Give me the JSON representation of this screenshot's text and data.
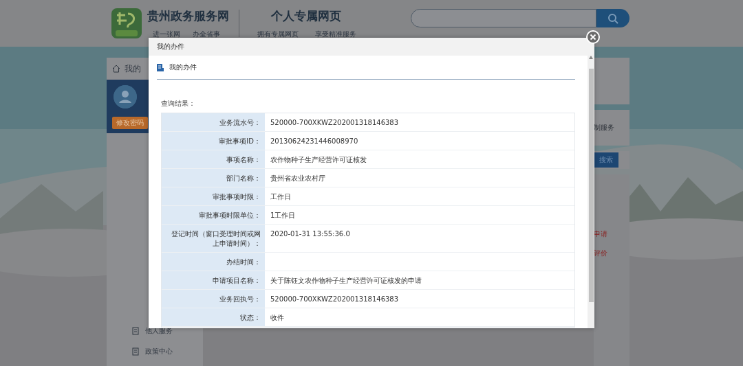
{
  "header": {
    "site_title": "贵州政务服务网",
    "page_title": "个人专属网页",
    "nav": [
      "进一张网",
      "办全省事",
      "拥有专属网页",
      "享受精准服务"
    ]
  },
  "sidebar": {
    "breadcrumb": "我的",
    "button": "修改密码",
    "items": [
      {
        "label": "他人服务"
      },
      {
        "label": "政策中心"
      }
    ]
  },
  "right_panel": {
    "service": "制服务",
    "search_button": "搜索",
    "links": [
      "申请",
      "评价"
    ]
  },
  "dialog": {
    "title": "我的办件",
    "heading": "我的办件",
    "result_label": "查询结果：",
    "rows": [
      {
        "label": "业务流水号：",
        "value": "520000-700XKWZ202001318146383"
      },
      {
        "label": "审批事项ID：",
        "value": "20130624231446008970"
      },
      {
        "label": "事项名称：",
        "value": "农作物种子生产经营许可证核发"
      },
      {
        "label": "部门名称：",
        "value": "贵州省农业农村厅"
      },
      {
        "label": "审批事项时限：",
        "value": "工作日"
      },
      {
        "label": "审批事项时限单位：",
        "value": "1工作日"
      },
      {
        "label": "登记时间（窗口受理时间或网上申请时间）：",
        "value": "2020-01-31 13:55:36.0"
      },
      {
        "label": "办结时间：",
        "value": ""
      },
      {
        "label": "申请项目名称：",
        "value": "关于陈钰文农作物种子生产经营许可证核发的申请"
      },
      {
        "label": "业务回执号：",
        "value": "520000-700XKWZ202001318146383"
      },
      {
        "label": "状态：",
        "value": "收件"
      }
    ]
  }
}
